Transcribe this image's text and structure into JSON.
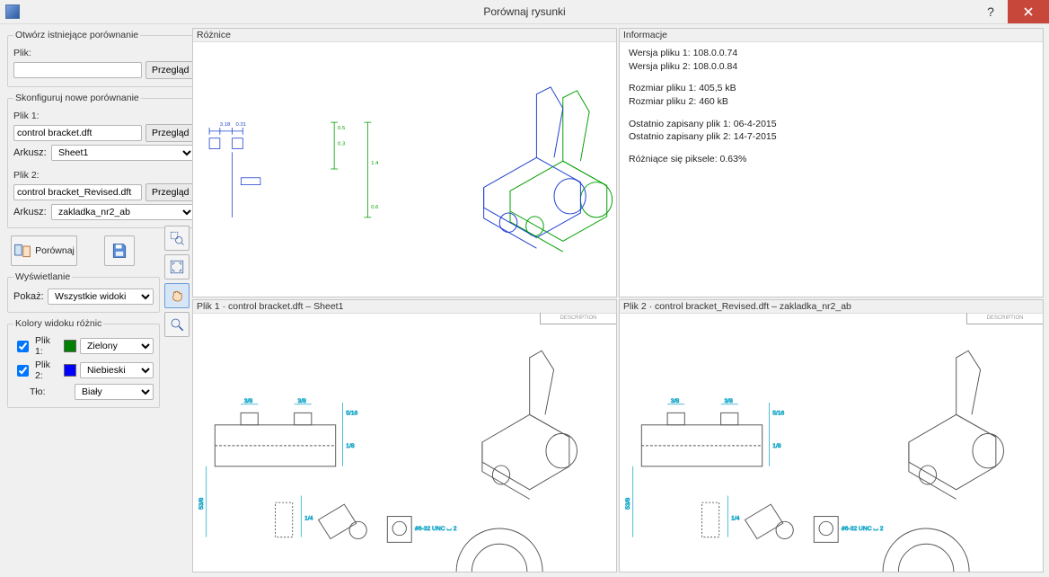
{
  "window": {
    "title": "Porównaj rysunki"
  },
  "open_existing": {
    "legend": "Otwórz istniejące porównanie",
    "file_label": "Plik:",
    "file_value": "",
    "browse": "Przegląd"
  },
  "configure_new": {
    "legend": "Skonfiguruj nowe porównanie",
    "file1_label": "Plik 1:",
    "file1_value": "control bracket.dft",
    "browse1": "Przegląd",
    "sheet_label": "Arkusz:",
    "sheet_value": "Sheet1",
    "file2_label": "Plik 2:",
    "file2_value": "control bracket_Revised.dft",
    "browse2": "Przegląd",
    "sheet2_label": "Arkusz:",
    "sheet2_value": "zakladka_nr2_ab"
  },
  "actions": {
    "compare": "Porównaj"
  },
  "display": {
    "legend": "Wyświetlanie",
    "show_label": "Pokaż:",
    "show_value": "Wszystkie widoki"
  },
  "colors": {
    "legend": "Kolory widoku różnic",
    "file1_label": "Plik 1:",
    "file1_color_name": "Zielony",
    "file1_color_hex": "#008000",
    "file2_label": "Plik 2:",
    "file2_color_name": "Niebieski",
    "file2_color_hex": "#0000ff",
    "bg_label": "Tło:",
    "bg_color_name": "Biały"
  },
  "panes": {
    "diff_title": "Różnice",
    "info_title": "Informacje",
    "file1_title": "Plik 1 · control bracket.dft – Sheet1",
    "file2_title": "Plik 2 · control bracket_Revised.dft – zakladka_nr2_ab",
    "titleblock": "DESCRIPTION"
  },
  "info": {
    "ver1": "Wersja pliku 1: 108.0.0.74",
    "ver2": "Wersja pliku 2: 108.0.0.84",
    "size1": "Rozmiar pliku 1: 405,5 kB",
    "size2": "Rozmiar pliku 2: 460 kB",
    "saved1": "Ostatnio zapisany plik 1: 06-4-2015",
    "saved2": "Ostatnio zapisany plik 2: 14-7-2015",
    "pixels": "Różniące się piksele: 0.63%"
  }
}
